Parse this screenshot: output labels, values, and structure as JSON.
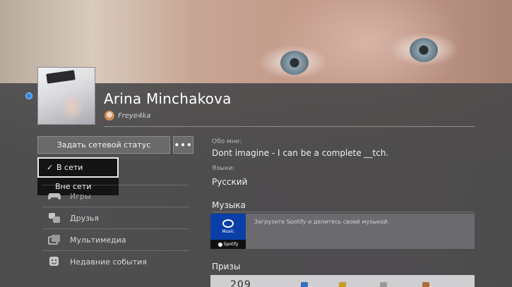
{
  "profile": {
    "name": "Arina Minchakova",
    "online_id": "Freye4ka",
    "status_color": "#2f8be6"
  },
  "actions": {
    "set_status_label": "Задать сетевой статус",
    "more_label": "•••"
  },
  "status_dropdown": {
    "options": [
      {
        "label": "В сети",
        "selected": true,
        "check": "✓"
      },
      {
        "label": "Вне сети",
        "selected": false
      }
    ]
  },
  "menu": {
    "items": [
      {
        "label": "Игры",
        "icon": "gamepad-icon"
      },
      {
        "label": "Друзья",
        "icon": "friends-icon"
      },
      {
        "label": "Мультимедиа",
        "icon": "media-icon"
      },
      {
        "label": "Недавние события",
        "icon": "events-icon"
      }
    ]
  },
  "about": {
    "label": "Обо мне:",
    "text": "Dont imagine - I can be a complete __tch."
  },
  "languages": {
    "label": "Языки:",
    "value": "Русский"
  },
  "music": {
    "title": "Музыка",
    "tile_label": "Music",
    "tile_brand": "Spotify",
    "prompt": "Загрузите Spotify и делитесь своей музыкой."
  },
  "trophies": {
    "title": "Призы",
    "level_partial": "209"
  }
}
